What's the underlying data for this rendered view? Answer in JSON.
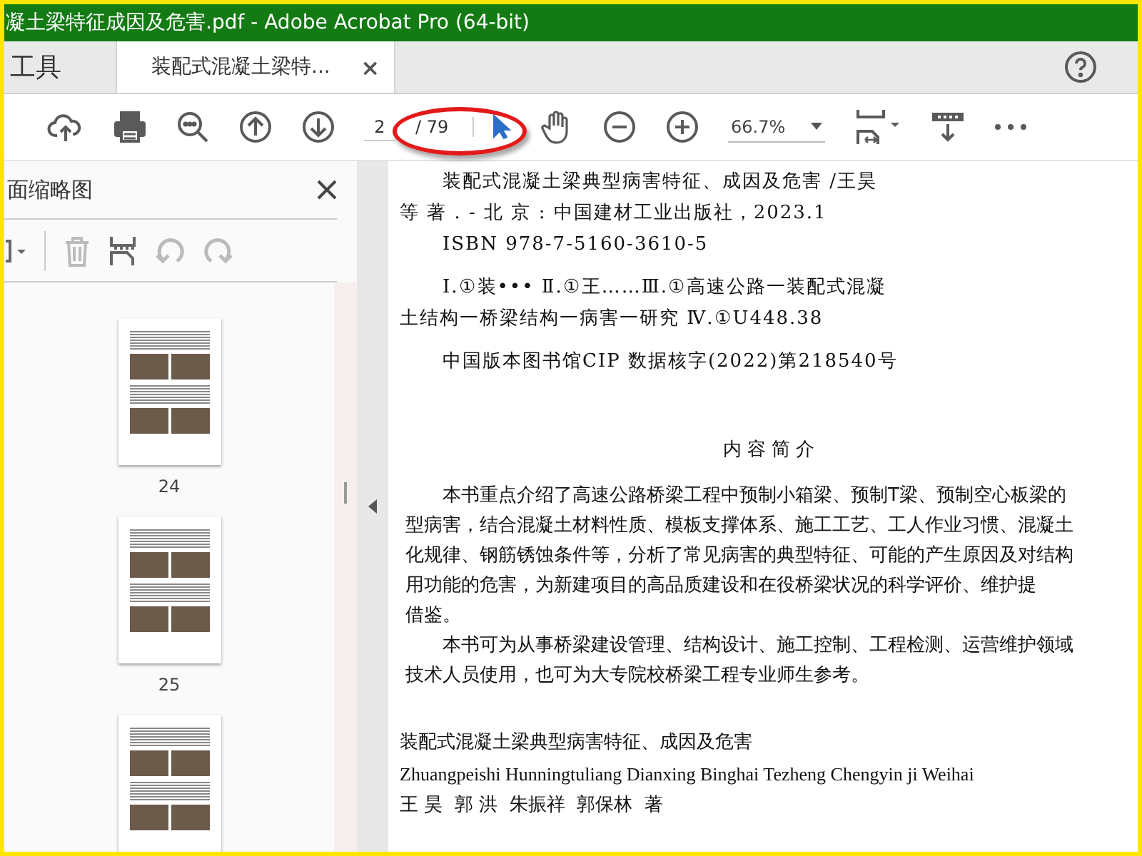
{
  "window": {
    "title": "凝土梁特征成因及危害.pdf - Adobe Acrobat Pro (64-bit)"
  },
  "tabs": [
    {
      "label": "工具",
      "selected": false
    },
    {
      "label": "装配式混凝土梁特...",
      "selected": true,
      "close_label": "×"
    }
  ],
  "toolbar": {
    "page_current": "2",
    "page_total": "/ 79",
    "zoom": "66.7%"
  },
  "sidebar": {
    "title": "面缩略图",
    "thumbnails": [
      {
        "kind": "page",
        "label": "24"
      },
      {
        "kind": "page",
        "label": "25"
      },
      {
        "kind": "cut"
      }
    ]
  },
  "document": {
    "blocks": [
      {
        "kind": "cip",
        "lines": [
          {
            "kind": "indented",
            "text": "装配式混凝土梁典型病害特征、成因及危害 /王昊"
          },
          {
            "kind": "flush",
            "text": "等 著 . - 北 京 : 中国建材工业出版社，2023.1"
          },
          {
            "kind": "indented",
            "text": "ISBN 978-7-5160-3610-5"
          }
        ]
      },
      {
        "kind": "cip",
        "lines": [
          {
            "kind": "indented",
            "text": "Ⅰ.①装••• Ⅱ.①王……Ⅲ.①高速公路一装配式混凝"
          },
          {
            "kind": "flush",
            "text": "土结构一桥梁结构一病害一研究 Ⅳ.①U448.38"
          }
        ]
      },
      {
        "kind": "cip",
        "lines": [
          {
            "kind": "indented",
            "text": "中国版本图书馆CIP 数据核字(2022)第218540号"
          }
        ]
      },
      {
        "kind": "heading",
        "lines": [
          {
            "kind": "heading",
            "text": "内 容 简 介"
          }
        ]
      },
      {
        "kind": "body",
        "lines": [
          {
            "kind": "para-first",
            "text": "本书重点介绍了高速公路桥梁工程中预制小箱梁、预制T梁、预制空心板梁的"
          },
          {
            "kind": "para",
            "text": "型病害，结合混凝土材料性质、模板支撑体系、施工工艺、工人作业习惯、混凝土"
          },
          {
            "kind": "para",
            "text": "化规律、钢筋锈蚀条件等，分析了常见病害的典型特征、可能的产生原因及对结构"
          },
          {
            "kind": "para",
            "text": "用功能的危害，为新建项目的高品质建设和在役桥梁状况的科学评价、维护提"
          },
          {
            "kind": "para",
            "text": "借鉴。"
          },
          {
            "kind": "para-first",
            "text": "本书可为从事桥梁建设管理、结构设计、施工控制、工程检测、运营维护领域"
          },
          {
            "kind": "para",
            "text": "技术人员使用，也可为大专院校桥梁工程专业师生参考。"
          }
        ]
      },
      {
        "kind": "credits",
        "lines": [
          {
            "kind": "plain",
            "text": "装配式混凝土梁典型病害特征、成因及危害"
          },
          {
            "kind": "latin",
            "text": "Zhuangpeishi Hunningtuliang Dianxing Binghai Tezheng Chengyin ji Weihai"
          },
          {
            "kind": "plain",
            "text": "王 昊  郭 洪  朱振祥  郭保林  著"
          }
        ]
      }
    ]
  }
}
